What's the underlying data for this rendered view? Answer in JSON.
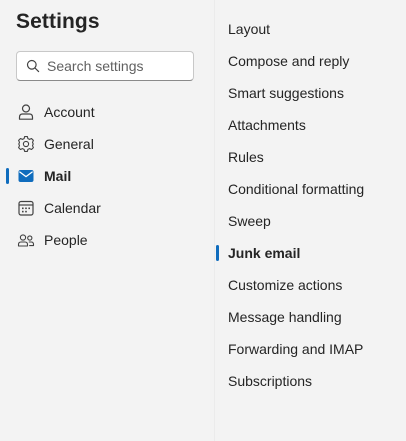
{
  "settings": {
    "title": "Settings",
    "search_placeholder": "Search settings"
  },
  "categories": [
    {
      "label": "Account",
      "icon": "person-icon",
      "active": false
    },
    {
      "label": "General",
      "icon": "gear-icon",
      "active": false
    },
    {
      "label": "Mail",
      "icon": "mail-icon",
      "active": true
    },
    {
      "label": "Calendar",
      "icon": "calendar-icon",
      "active": false
    },
    {
      "label": "People",
      "icon": "people-icon",
      "active": false
    }
  ],
  "mail_sections": [
    {
      "label": "Layout",
      "active": false
    },
    {
      "label": "Compose and reply",
      "active": false
    },
    {
      "label": "Smart suggestions",
      "active": false
    },
    {
      "label": "Attachments",
      "active": false
    },
    {
      "label": "Rules",
      "active": false
    },
    {
      "label": "Conditional formatting",
      "active": false
    },
    {
      "label": "Sweep",
      "active": false
    },
    {
      "label": "Junk email",
      "active": true
    },
    {
      "label": "Customize actions",
      "active": false
    },
    {
      "label": "Message handling",
      "active": false
    },
    {
      "label": "Forwarding and IMAP",
      "active": false
    },
    {
      "label": "Subscriptions",
      "active": false
    }
  ],
  "colors": {
    "accent": "#0f6cbd",
    "background": "#f3f3f3",
    "text": "#242424"
  }
}
